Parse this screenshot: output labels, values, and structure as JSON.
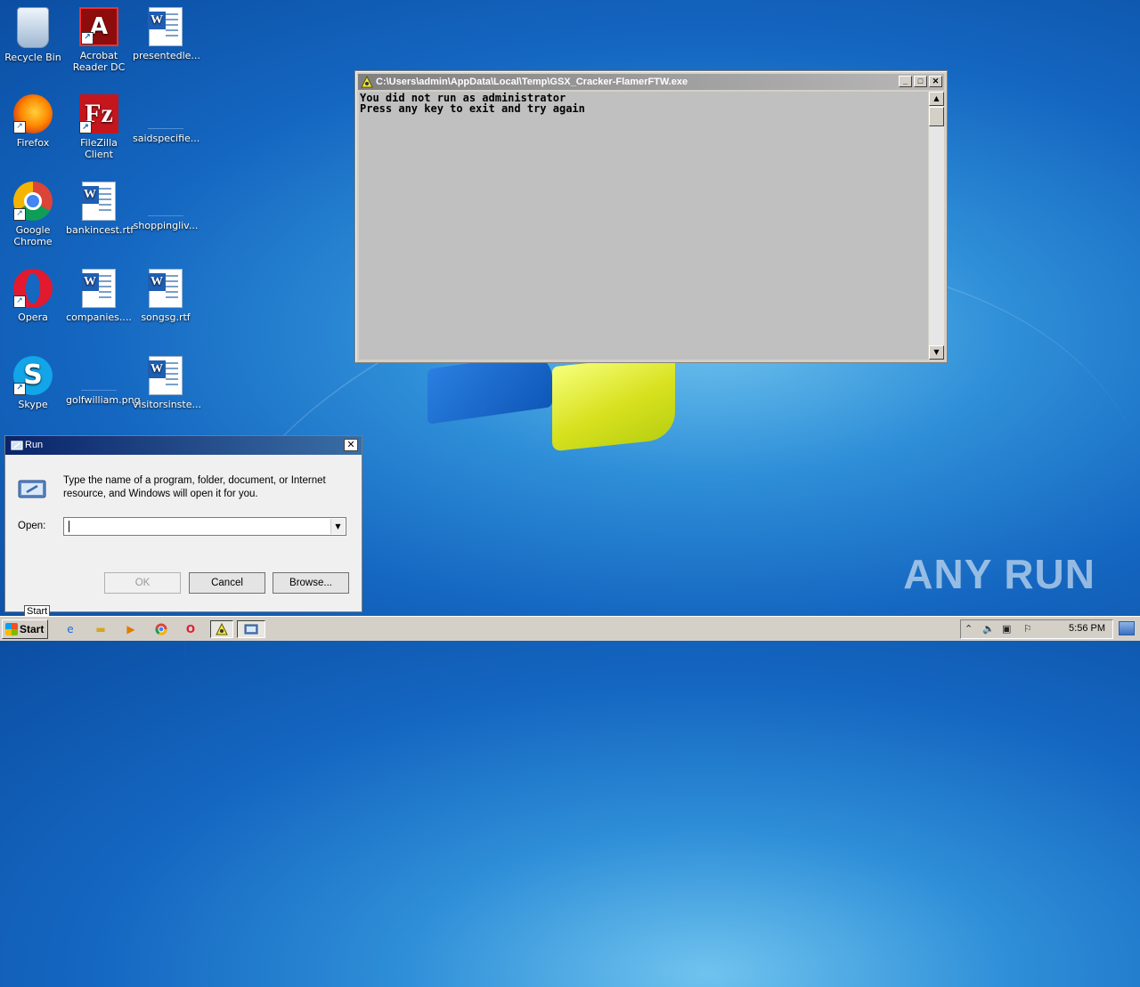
{
  "desktop": {
    "icons": [
      {
        "label": "Recycle Bin",
        "icon": "recycle-bin-icon"
      },
      {
        "label": "Acrobat Reader DC",
        "icon": "acrobat-reader-icon"
      },
      {
        "label": "presentedle...",
        "icon": "word-document-icon"
      },
      {
        "label": "Firefox",
        "icon": "firefox-icon"
      },
      {
        "label": "FileZilla Client",
        "icon": "filezilla-icon"
      },
      {
        "label": "saidspecifie...",
        "icon": "blank-file-icon"
      },
      {
        "label": "Google Chrome",
        "icon": "chrome-icon"
      },
      {
        "label": "bankincest.rtf",
        "icon": "word-document-icon"
      },
      {
        "label": "shoppingliv...",
        "icon": "blank-file-icon"
      },
      {
        "label": "Opera",
        "icon": "opera-icon"
      },
      {
        "label": "companies....",
        "icon": "word-document-icon"
      },
      {
        "label": "songsg.rtf",
        "icon": "word-document-icon"
      },
      {
        "label": "Skype",
        "icon": "skype-icon"
      },
      {
        "label": "golfwilliam.png",
        "icon": "image-file-icon"
      },
      {
        "label": "visitorsinste...",
        "icon": "word-document-icon"
      }
    ],
    "watermark": "ANY RUN"
  },
  "console": {
    "title": "C:\\Users\\admin\\AppData\\Local\\Temp\\GSX_Cracker-FlamerFTW.exe",
    "lines": [
      "You did not run as administrator",
      "Press any key to exit and try again"
    ]
  },
  "run_dialog": {
    "title": "Run",
    "description": "Type the name of a program, folder, document, or Internet resource, and Windows will open it for you.",
    "open_label": "Open:",
    "open_value": "",
    "ok_label": "OK",
    "cancel_label": "Cancel",
    "browse_label": "Browse..."
  },
  "tooltip": "Start",
  "taskbar": {
    "start_label": "Start",
    "clock": "5:56 PM"
  },
  "colors": {
    "console_bg": "#c0c0c0",
    "run_titlebar": "#0a246a",
    "taskbar_bg": "#d4d0c8"
  }
}
